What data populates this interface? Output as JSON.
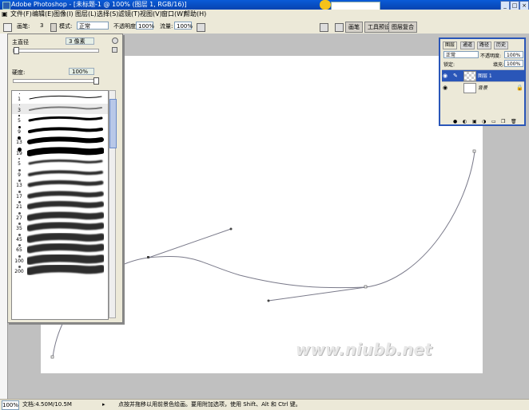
{
  "title": "Adobe Photoshop - [未标题-1 @ 100% (图层 1, RGB/16)]",
  "menu": [
    "文件(F)",
    "编辑(E)",
    "图像(I)",
    "图层(L)",
    "选择(S)",
    "滤镜(T)",
    "视图(V)",
    "窗口(W)",
    "帮助(H)"
  ],
  "options": {
    "brush_label": "画笔:",
    "brush_size": "3",
    "mode_label": "模式:",
    "mode_value": "正常",
    "opacity_label": "不透明度:",
    "opacity_value": "100%",
    "flow_label": "流量:",
    "flow_value": "100%",
    "wells": [
      "画笔",
      "工具预设",
      "图层复合"
    ]
  },
  "brush_panel": {
    "diameter_label": "主直径",
    "diameter_value": "3 像素",
    "hardness_label": "硬度:",
    "hardness_value": "100%",
    "hardness_fraction": 1.0,
    "presets": [
      {
        "size": "1",
        "dot": 1,
        "stroke": 1,
        "soft": false
      },
      {
        "size": "3",
        "dot": 1,
        "stroke": 2,
        "soft": false
      },
      {
        "size": "5",
        "dot": 2,
        "stroke": 3,
        "soft": false
      },
      {
        "size": "9",
        "dot": 3,
        "stroke": 4,
        "soft": false
      },
      {
        "size": "13",
        "dot": 4,
        "stroke": 6,
        "soft": false
      },
      {
        "size": "19",
        "dot": 5,
        "stroke": 8,
        "soft": false
      },
      {
        "size": "5",
        "dot": 2,
        "stroke": 3,
        "soft": true
      },
      {
        "size": "9",
        "dot": 3,
        "stroke": 4,
        "soft": true
      },
      {
        "size": "13",
        "dot": 3,
        "stroke": 5,
        "soft": true
      },
      {
        "size": "17",
        "dot": 3,
        "stroke": 6,
        "soft": true
      },
      {
        "size": "21",
        "dot": 3,
        "stroke": 7,
        "soft": true
      },
      {
        "size": "27",
        "dot": 3,
        "stroke": 8,
        "soft": true
      },
      {
        "size": "35",
        "dot": 3,
        "stroke": 8,
        "soft": true
      },
      {
        "size": "45",
        "dot": 3,
        "stroke": 9,
        "soft": true
      },
      {
        "size": "65",
        "dot": 3,
        "stroke": 9,
        "soft": true
      },
      {
        "size": "100",
        "dot": 3,
        "stroke": 10,
        "soft": true
      },
      {
        "size": "200",
        "dot": 3,
        "stroke": 10,
        "soft": true
      }
    ]
  },
  "layers": {
    "tabs": [
      "图层",
      "通道",
      "路径",
      "历史"
    ],
    "blend": "正常",
    "opacity_label": "不透明度:",
    "opacity": "100%",
    "lock_label": "锁定:",
    "fill_label": "填充:",
    "fill": "100%",
    "items": [
      {
        "name": "图层 1",
        "selected": true,
        "transparent": true,
        "locked": false
      },
      {
        "name": "背景",
        "selected": false,
        "transparent": false,
        "locked": true
      }
    ]
  },
  "status": {
    "zoom": "100%",
    "doc": "文档:4.50M/10.5M",
    "hint": "点按并拖移以用前景色绘画。要用附加选项，使用 Shift、Alt 和 Ctrl 键。"
  },
  "watermark": "www.niubb.net"
}
